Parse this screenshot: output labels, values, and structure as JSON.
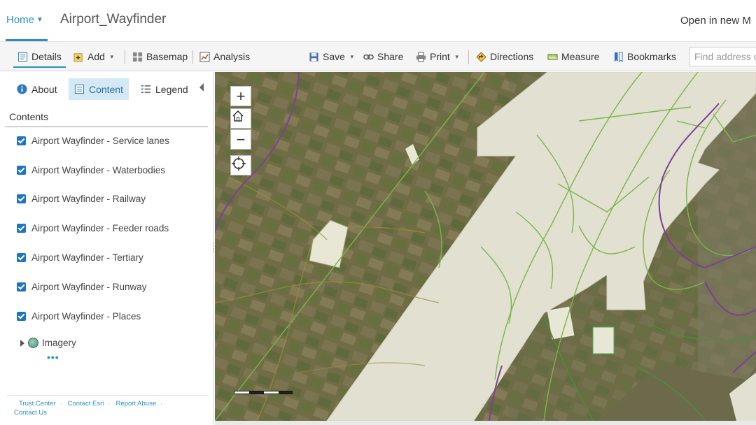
{
  "header": {
    "home_label": "Home",
    "app_title": "Airport_Wayfinder",
    "open_new": "Open in new M"
  },
  "toolbar": {
    "details": "Details",
    "add": "Add",
    "basemap": "Basemap",
    "analysis": "Analysis",
    "save": "Save",
    "share": "Share",
    "print": "Print",
    "directions": "Directions",
    "measure": "Measure",
    "bookmarks": "Bookmarks",
    "search_placeholder": "Find address o"
  },
  "panel": {
    "tabs": {
      "about": "About",
      "content": "Content",
      "legend": "Legend"
    },
    "contents_title": "Contents",
    "layers": [
      {
        "label": "Airport Wayfinder - Service lanes",
        "checked": true
      },
      {
        "label": "Airport Wayfinder - Waterbodies",
        "checked": true
      },
      {
        "label": "Airport Wayfinder - Railway",
        "checked": true
      },
      {
        "label": "Airport Wayfinder - Feeder roads",
        "checked": true
      },
      {
        "label": "Airport Wayfinder - Tertiary",
        "checked": true
      },
      {
        "label": "Airport Wayfinder - Runway",
        "checked": true
      },
      {
        "label": "Airport Wayfinder - Places",
        "checked": true
      }
    ],
    "basemap_layer": "Imagery",
    "more": "•••",
    "footer": {
      "trust_center": "Trust Center",
      "contact_esri": "Contact Esri",
      "report_abuse": "Report Abuse",
      "contact_us": "Contact Us"
    }
  },
  "map": {
    "zoom_in": "+",
    "zoom_out": "−",
    "colors": {
      "runway": "#e2e0d0",
      "service_lane": "#7ab648",
      "railway": "#7e3f98",
      "imagery_base": "#6f6a45"
    }
  },
  "colors": {
    "accent": "#2b8fc5",
    "checkbox": "#1f73c4",
    "selected_tab": "#d5e8f6"
  }
}
